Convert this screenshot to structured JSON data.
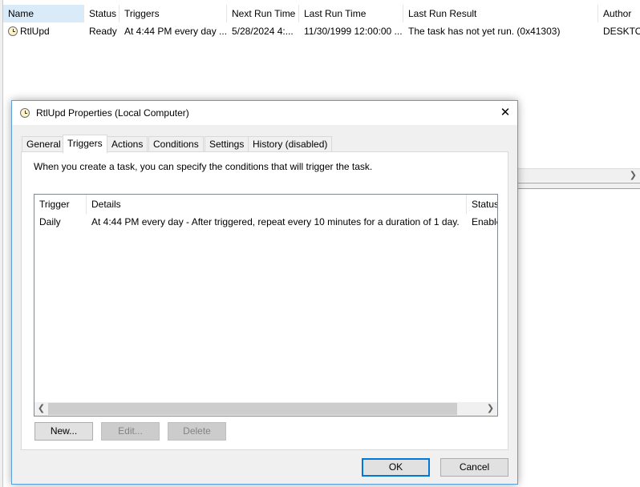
{
  "task_list": {
    "columns": [
      "Name",
      "Status",
      "Triggers",
      "Next Run Time",
      "Last Run Time",
      "Last Run Result",
      "Author"
    ],
    "rows": [
      {
        "name": "RtlUpd",
        "status": "Ready",
        "triggers": "At 4:44 PM every day ...",
        "next_run_time": "5/28/2024 4:...",
        "last_run_time": "11/30/1999 12:00:00 ...",
        "last_run_result": "The task has not yet run. (0x41303)",
        "author": "DESKTOP"
      }
    ]
  },
  "dialog": {
    "title": "RtlUpd Properties (Local Computer)",
    "close_glyph": "✕",
    "tabs": [
      "General",
      "Triggers",
      "Actions",
      "Conditions",
      "Settings",
      "History (disabled)"
    ],
    "active_tab": "Triggers",
    "description": "When you create a task, you can specify the conditions that will trigger the task.",
    "trigger_table": {
      "columns": [
        "Trigger",
        "Details",
        "Status"
      ],
      "rows": [
        {
          "trigger": "Daily",
          "details": "At 4:44 PM every day - After triggered, repeat every 10 minutes for a duration of 1 day.",
          "status": "Enabled"
        }
      ]
    },
    "buttons": {
      "new": "New...",
      "edit": "Edit...",
      "delete": "Delete",
      "ok": "OK",
      "cancel": "Cancel"
    }
  },
  "icons": {
    "scroll_left": "❮",
    "scroll_right": "❯"
  },
  "colors": {
    "dialog_border": "#5a9fd8",
    "default_button_border": "#0078d7",
    "sorted_column": "#d9ebf9"
  }
}
